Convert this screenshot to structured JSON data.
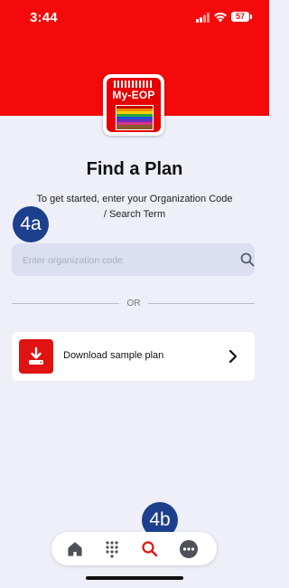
{
  "status_bar": {
    "time": "3:44",
    "battery": "57"
  },
  "app": {
    "logo_text": "My-EOP"
  },
  "main": {
    "title": "Find a Plan",
    "subtitle": "To get started, enter your Organization Code / Search Term",
    "search": {
      "placeholder": "Enter organization code",
      "value": ""
    },
    "divider_text": "OR",
    "sample_plan": {
      "label": "Download sample plan",
      "icon": "download-icon"
    }
  },
  "annotations": {
    "badge_a": "4a",
    "badge_b": "4b"
  },
  "bottom_nav": {
    "items": [
      {
        "name": "home",
        "icon": "home-icon",
        "active": false
      },
      {
        "name": "keypad",
        "icon": "keypad-icon",
        "active": false
      },
      {
        "name": "search",
        "icon": "search-icon",
        "active": true
      },
      {
        "name": "more",
        "icon": "more-icon",
        "active": false
      }
    ]
  },
  "colors": {
    "brand_red": "#f40a0a",
    "badge_blue": "#1c3f8e",
    "background": "#eeeff8"
  }
}
